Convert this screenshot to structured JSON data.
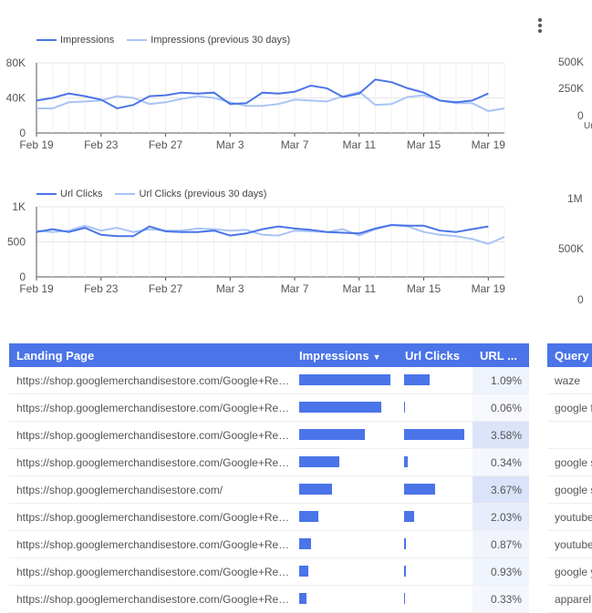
{
  "menu": {
    "icon": "more-vert-icon"
  },
  "charts": [
    {
      "name": "impressions-chart",
      "legend": [
        {
          "label": "Impressions",
          "color": "#4a74e8"
        },
        {
          "label": "Impressions (previous 30 days)",
          "color": "#a9c4f5"
        }
      ],
      "yticks": [
        "80K",
        "40K",
        "0"
      ],
      "ymax": 80000
    },
    {
      "name": "clicks-chart",
      "legend": [
        {
          "label": "Url Clicks",
          "color": "#4a74e8"
        },
        {
          "label": "Url Clicks (previous 30 days)",
          "color": "#a9c4f5"
        }
      ],
      "yticks": [
        "1K",
        "500",
        "0"
      ],
      "ymax": 1000
    }
  ],
  "chart_data": [
    {
      "type": "line",
      "x": [
        "Feb 19",
        "Feb 20",
        "Feb 21",
        "Feb 22",
        "Feb 23",
        "Feb 24",
        "Feb 25",
        "Feb 26",
        "Feb 27",
        "Feb 28",
        "Mar 1",
        "Mar 2",
        "Mar 3",
        "Mar 4",
        "Mar 5",
        "Mar 6",
        "Mar 7",
        "Mar 8",
        "Mar 9",
        "Mar 10",
        "Mar 11",
        "Mar 12",
        "Mar 13",
        "Mar 14",
        "Mar 15",
        "Mar 16",
        "Mar 17",
        "Mar 18",
        "Mar 19",
        "Mar 20"
      ],
      "xticks": [
        "Feb 19",
        "Feb 23",
        "Feb 27",
        "Mar 3",
        "Mar 7",
        "Mar 11",
        "Mar 15",
        "Mar 19"
      ],
      "series": [
        {
          "name": "Impressions",
          "values": [
            37000,
            40000,
            45000,
            42000,
            38000,
            28000,
            32000,
            42000,
            43000,
            46000,
            45000,
            46000,
            33000,
            34000,
            46000,
            45000,
            47000,
            54000,
            51000,
            41000,
            45000,
            61000,
            58000,
            51000,
            46000,
            37000,
            35000,
            37000,
            45000,
            null
          ]
        },
        {
          "name": "Impressions (previous 30 days)",
          "values": [
            28000,
            28000,
            35000,
            36000,
            37000,
            42000,
            40000,
            33000,
            35000,
            39000,
            42000,
            40000,
            35000,
            31000,
            31000,
            33000,
            38000,
            37000,
            36000,
            42000,
            47000,
            32000,
            33000,
            41000,
            43000,
            37000,
            34000,
            34000,
            25000,
            28000
          ]
        }
      ],
      "ylim": [
        0,
        80000
      ]
    },
    {
      "type": "line",
      "x": [
        "Feb 19",
        "Feb 20",
        "Feb 21",
        "Feb 22",
        "Feb 23",
        "Feb 24",
        "Feb 25",
        "Feb 26",
        "Feb 27",
        "Feb 28",
        "Mar 1",
        "Mar 2",
        "Mar 3",
        "Mar 4",
        "Mar 5",
        "Mar 6",
        "Mar 7",
        "Mar 8",
        "Mar 9",
        "Mar 10",
        "Mar 11",
        "Mar 12",
        "Mar 13",
        "Mar 14",
        "Mar 15",
        "Mar 16",
        "Mar 17",
        "Mar 18",
        "Mar 19",
        "Mar 20"
      ],
      "xticks": [
        "Feb 19",
        "Feb 23",
        "Feb 27",
        "Mar 3",
        "Mar 7",
        "Mar 11",
        "Mar 15",
        "Mar 19"
      ],
      "series": [
        {
          "name": "Url Clicks",
          "values": [
            640,
            680,
            640,
            700,
            600,
            580,
            580,
            720,
            650,
            640,
            640,
            660,
            590,
            620,
            680,
            720,
            690,
            670,
            640,
            630,
            620,
            690,
            740,
            730,
            730,
            660,
            640,
            680,
            720,
            null
          ]
        },
        {
          "name": "Url Clicks (previous 30 days)",
          "values": [
            660,
            640,
            660,
            730,
            660,
            700,
            640,
            680,
            660,
            660,
            690,
            680,
            660,
            670,
            600,
            590,
            660,
            650,
            640,
            680,
            590,
            680,
            740,
            720,
            640,
            600,
            580,
            540,
            470,
            570
          ]
        }
      ],
      "ylim": [
        0,
        1000
      ]
    }
  ],
  "right_axis_1": [
    "500K",
    "250K",
    "0",
    "Ur"
  ],
  "right_axis_2": [
    "1M",
    "500K",
    "0"
  ],
  "table": {
    "headers": [
      "Landing Page",
      "Impressions",
      "Url Clicks",
      "URL ..."
    ],
    "sort_icon": "caret-down-icon",
    "bar_color": "#4a74e8",
    "rows": [
      {
        "page": "https://shop.googlemerchandisestore.com/Google+Redesign/",
        "impressions": 1.0,
        "clicks": 0.42,
        "ctr": "1.09%"
      },
      {
        "page": "https://shop.googlemerchandisestore.com/Google+Redesign/",
        "impressions": 0.9,
        "clicks": 0.01,
        "ctr": "0.06%"
      },
      {
        "page": "https://shop.googlemerchandisestore.com/Google+Redesign/",
        "impressions": 0.72,
        "clicks": 1.0,
        "ctr": "3.58%"
      },
      {
        "page": "https://shop.googlemerchandisestore.com/Google+Redesign/",
        "impressions": 0.44,
        "clicks": 0.06,
        "ctr": "0.34%"
      },
      {
        "page": "https://shop.googlemerchandisestore.com/",
        "impressions": 0.36,
        "clicks": 0.52,
        "ctr": "3.67%"
      },
      {
        "page": "https://shop.googlemerchandisestore.com/Google+Redesign/",
        "impressions": 0.21,
        "clicks": 0.17,
        "ctr": "2.03%"
      },
      {
        "page": "https://shop.googlemerchandisestore.com/Google+Redesign/",
        "impressions": 0.13,
        "clicks": 0.03,
        "ctr": "0.87%"
      },
      {
        "page": "https://shop.googlemerchandisestore.com/Google+Redesign/",
        "impressions": 0.1,
        "clicks": 0.03,
        "ctr": "0.93%"
      },
      {
        "page": "https://shop.googlemerchandisestore.com/Google+Redesign/",
        "impressions": 0.08,
        "clicks": 0.01,
        "ctr": "0.33%"
      }
    ],
    "ctr_max": 3.67
  },
  "query_table": {
    "header": "Query",
    "rows": [
      "waze",
      "google f",
      "",
      "google s",
      "google s",
      "youtube",
      "youtube",
      "google y",
      "apparel"
    ]
  }
}
